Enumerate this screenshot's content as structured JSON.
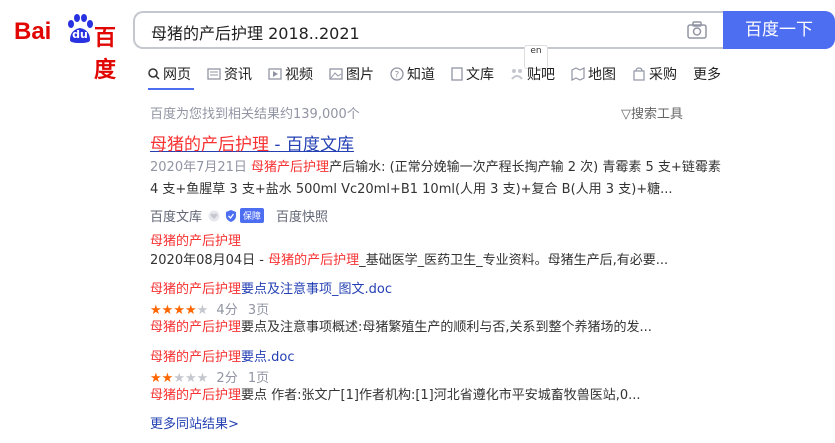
{
  "logo": {
    "bai": "Bai",
    "du": "du",
    "cn": "百度"
  },
  "search": {
    "query": "母猪的产后护理 2018..2021",
    "button_label": "百度一下"
  },
  "translate_badge": "en",
  "tabs": [
    {
      "label": "网页",
      "icon": "search-icon"
    },
    {
      "label": "资讯",
      "icon": "news-icon"
    },
    {
      "label": "视频",
      "icon": "video-icon"
    },
    {
      "label": "图片",
      "icon": "image-icon"
    },
    {
      "label": "知道",
      "icon": "question-icon"
    },
    {
      "label": "文库",
      "icon": "document-icon"
    },
    {
      "label": "贴吧",
      "icon": "tieba-icon"
    },
    {
      "label": "地图",
      "icon": "map-icon"
    },
    {
      "label": "采购",
      "icon": "purchase-icon"
    },
    {
      "label": "更多",
      "icon": ""
    }
  ],
  "result_count": "百度为您找到相关结果约139,000个",
  "search_tools": "搜索工具",
  "result": {
    "title_red": "母猪的产后护理",
    "title_rest": " - 百度文库",
    "snippet1_date": "2020年7月21日",
    "snippet1_red": "母猪产后护理",
    "snippet1_text": "产后输水: (正常分娩输一次产程长掏产输 2 次) 青霉素 5 支+链霉素",
    "snippet1_line2": "4 支+鱼腥草 3 支+盐水 500ml Vc20ml+B1 10ml(人用 3 支)+复合 B(人用 3 支)+糖...",
    "source": "百度文库",
    "badge": "保障",
    "snapshot": "百度快照",
    "sub1_title": "母猪的产后护理",
    "sub1_date": "2020年08月04日 - ",
    "sub1_red": "母猪的产后护理",
    "sub1_text": "_基础医学_医药卫生_专业资料。母猪生产后,有必要...",
    "sub2_red": "母猪的产后护理",
    "sub2_rest": "要点及注意事项_图文.doc",
    "sub2_rating": "4分",
    "sub2_pages": "3页",
    "sub2_snip_red": "母猪的产后护理",
    "sub2_snip": "要点及注意事项概述:母猪繁殖生产的顺利与否,关系到整个养猪场的发...",
    "sub3_red": "母猪的产后护理",
    "sub3_rest": "要点.doc",
    "sub3_rating": "2分",
    "sub3_pages": "1页",
    "sub3_snip_red": "母猪的产后护理",
    "sub3_snip": "要点 作者:张文广[1]作者机构:[1]河北省遵化市平安城畜牧兽医站,0...",
    "more": "更多同站结果>"
  },
  "ratings": {
    "sub2_stars": 4,
    "sub3_stars": 2,
    "max_stars": 5
  },
  "colors": {
    "accent": "#4e6ef2",
    "link": "#2440b3",
    "highlight": "#f73131",
    "brand_red": "#e10602",
    "star": "#ff6600"
  }
}
